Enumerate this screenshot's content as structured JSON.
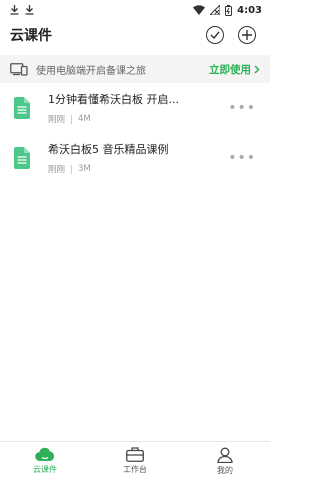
{
  "status_bar": {
    "time": "4:03"
  },
  "header": {
    "title": "云课件"
  },
  "banner": {
    "message": "使用电脑端开启备课之旅",
    "cta": "立即使用"
  },
  "files": [
    {
      "title": "1分钟看懂希沃白板 开启...",
      "time": "刚刚",
      "size": "4M"
    },
    {
      "title": "希沃白板5 音乐精品课例",
      "time": "刚刚",
      "size": "3M"
    }
  ],
  "tabs": [
    {
      "label": "云课件",
      "active": true
    },
    {
      "label": "工作台",
      "active": false
    },
    {
      "label": "我的",
      "active": false
    }
  ],
  "colors": {
    "accent": "#2fb15a",
    "file_icon": "#4cc98a"
  }
}
